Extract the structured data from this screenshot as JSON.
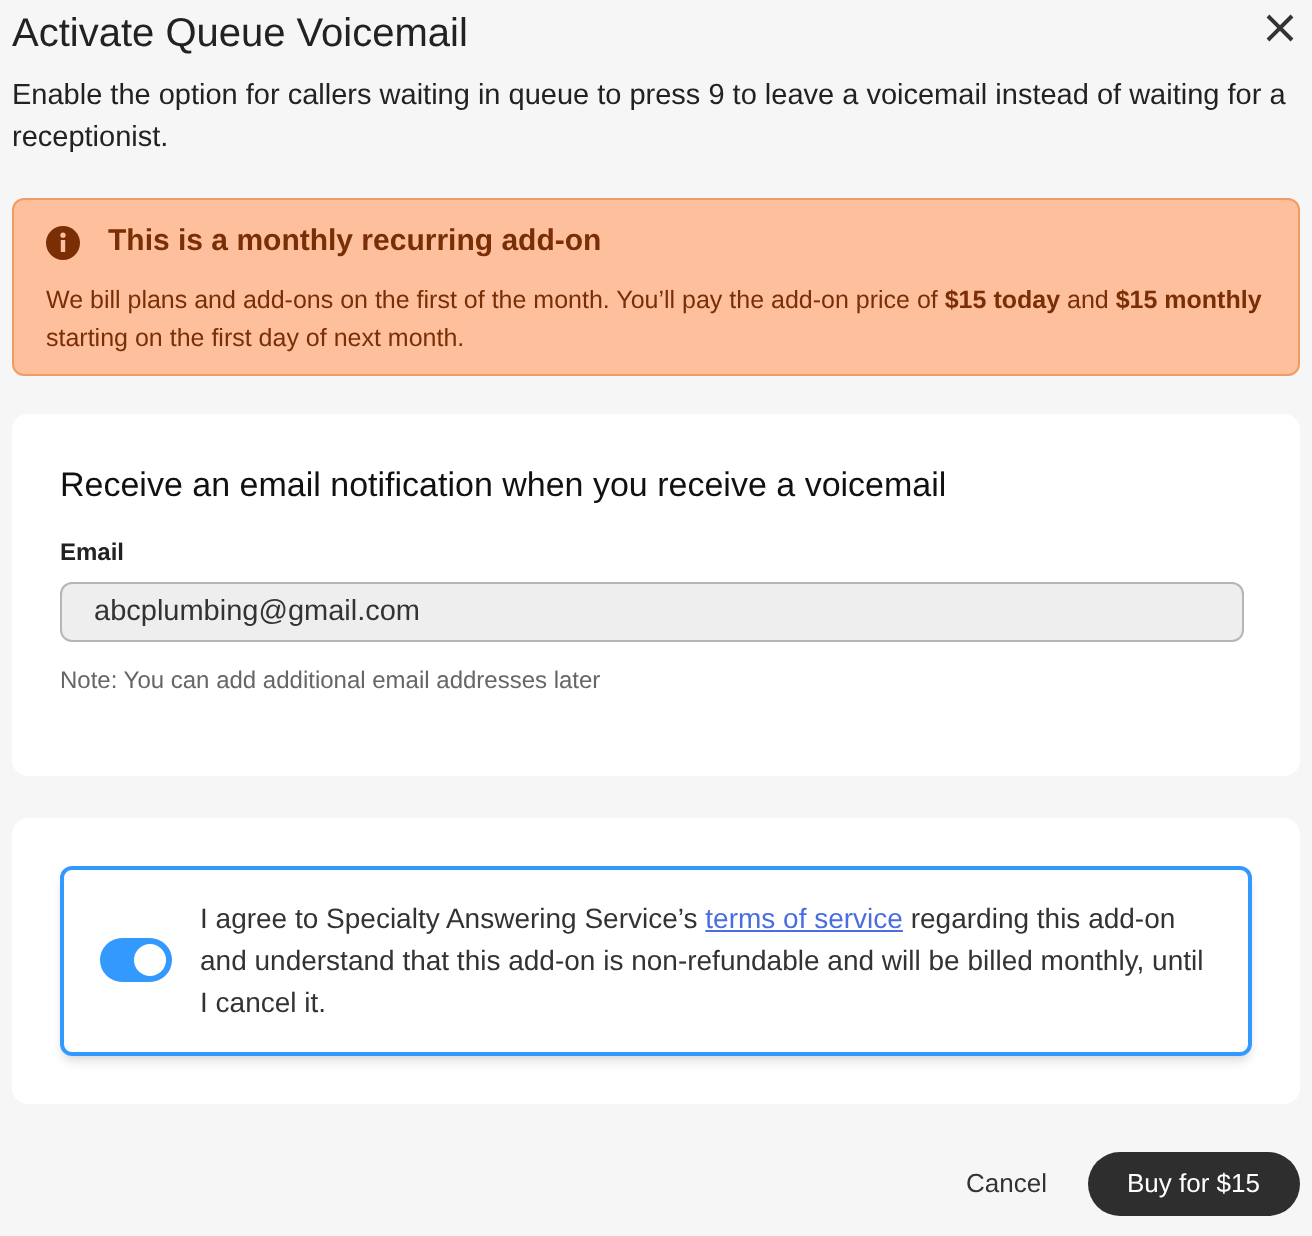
{
  "dialog": {
    "title": "Activate Queue Voicemail",
    "description": "Enable the option for callers waiting in queue to press 9 to leave a voicemail instead of waiting for a receptionist."
  },
  "alert": {
    "title": "This is a monthly recurring add-on",
    "body": "We bill plans and add-ons on the first of the month. You’ll pay the add-on price of **$15 today** and **$15 monthly** starting on the first day of next month."
  },
  "email_card": {
    "heading": "Receive an email notification when you receive a voicemail",
    "label": "Email",
    "value": "abcplumbing@gmail.com",
    "disabled": true,
    "note": "Note: You can add additional email addresses later"
  },
  "agreement": {
    "on": true,
    "text_before": "I agree to Specialty Answering Service’s ",
    "link": "terms of service",
    "text_after": " regarding this add-on and understand that this add-on is non-refundable and will be billed monthly, until I cancel it."
  },
  "buttons": [
    {
      "label": "Cancel",
      "kind": "text"
    },
    {
      "label": "Buy for $15",
      "kind": "primary"
    }
  ]
}
